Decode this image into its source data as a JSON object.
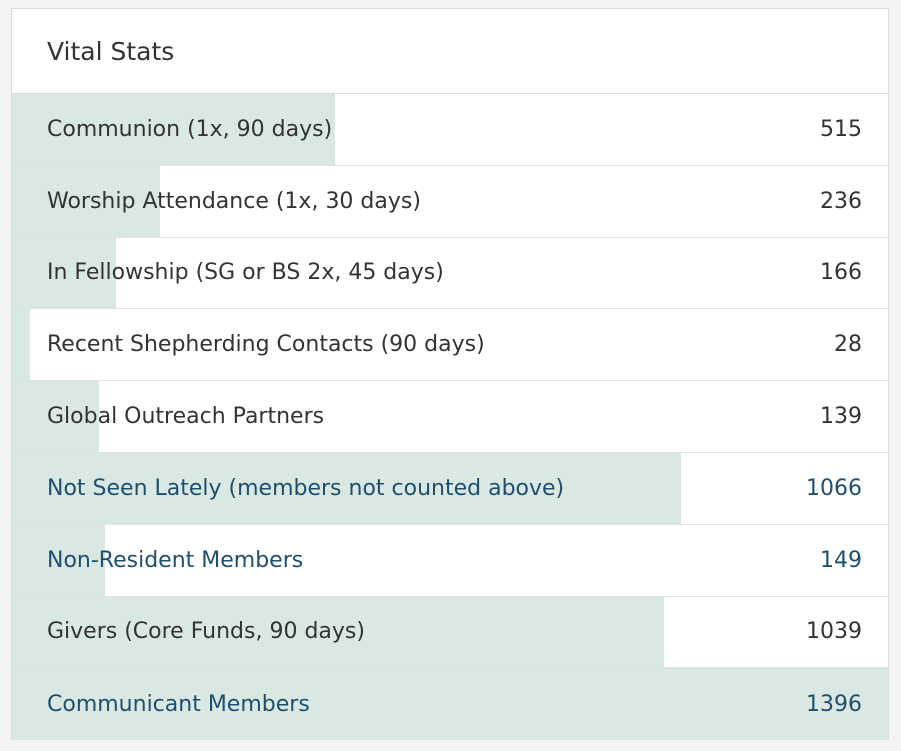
{
  "panel": {
    "title": "Vital Stats",
    "max_value": 1396,
    "bar_color": "#d9e8e2",
    "link_color": "#1f4e6f",
    "rows": [
      {
        "label": "Communion (1x, 90 days)",
        "value": "515",
        "link": false
      },
      {
        "label": "Worship Attendance (1x, 30 days)",
        "value": "236",
        "link": false
      },
      {
        "label": "In Fellowship (SG or BS 2x, 45 days)",
        "value": "166",
        "link": false
      },
      {
        "label": "Recent Shepherding Contacts (90 days)",
        "value": "28",
        "link": false
      },
      {
        "label": "Global Outreach Partners",
        "value": "139",
        "link": false
      },
      {
        "label": "Not Seen Lately (members not counted above)",
        "value": "1066",
        "link": true
      },
      {
        "label": "Non-Resident Members",
        "value": "149",
        "link": true
      },
      {
        "label": "Givers (Core Funds, 90 days)",
        "value": "1039",
        "link": false
      },
      {
        "label": "Communicant Members",
        "value": "1396",
        "link": true
      }
    ]
  }
}
